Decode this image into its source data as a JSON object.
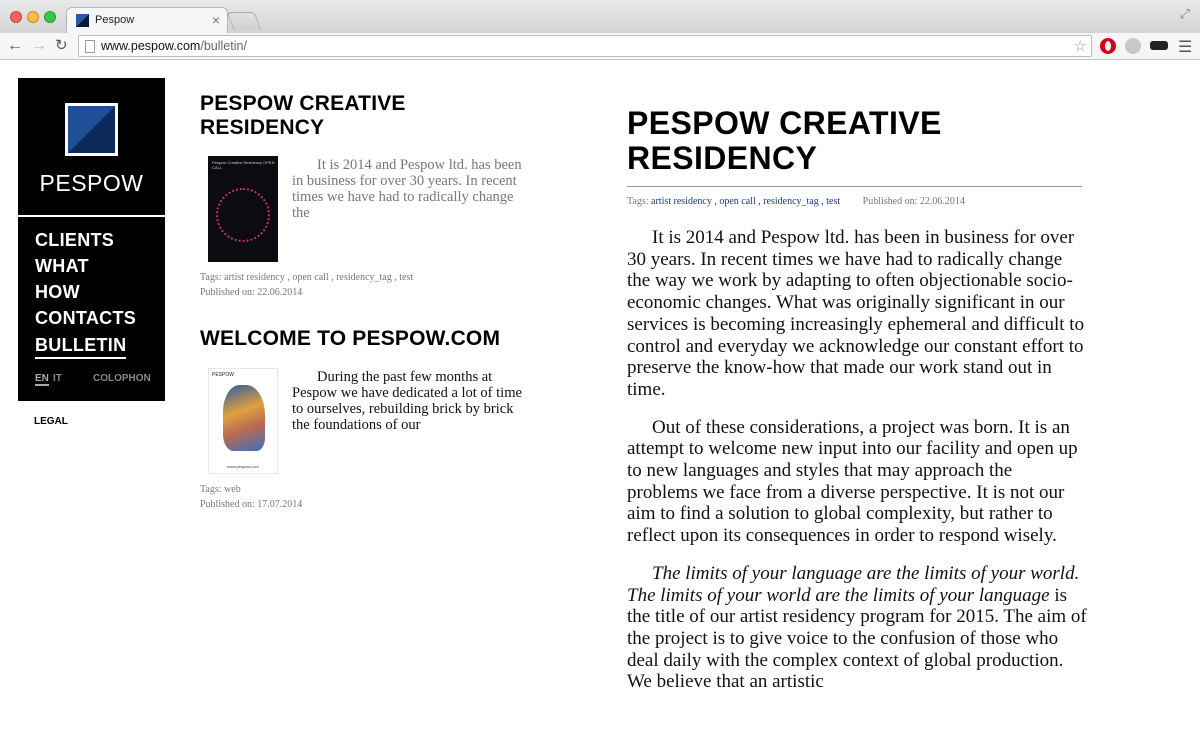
{
  "browser": {
    "tab_title": "Pespow",
    "tab_close": "×",
    "url_host": "www.pespow.com",
    "url_path": "/bulletin/",
    "icons": [
      "back-arrow-icon",
      "forward-arrow-icon",
      "reload-icon",
      "star-icon",
      "menu-icon"
    ]
  },
  "sidebar": {
    "logo_text": "PESPOW",
    "nav": [
      {
        "label": "CLIENTS"
      },
      {
        "label": "WHAT"
      },
      {
        "label": "HOW"
      },
      {
        "label": "CONTACTS"
      },
      {
        "label": "BULLETIN",
        "active": true
      }
    ],
    "lang_en": "EN",
    "lang_it": "IT",
    "colophon": "COLOPHON",
    "legal": "LEGAL"
  },
  "posts": [
    {
      "title_line1": "PESPOW CREATIVE",
      "title_line2": "RESIDENCY",
      "excerpt": "It is 2014 and Pespow ltd. has been in business for over 30 years. In recent times we have had to radically change the",
      "tags_label": "Tags:",
      "tags": "artist residency , open call , residency_tag , test",
      "published": "Published on: 22.06.2014"
    },
    {
      "title": "WELCOME TO PESPOW.COM",
      "excerpt": "During the past few months at Pespow we have dedicated a lot of time to ourselves, rebuilding brick by brick the foundations of our",
      "tags_label": "Tags:",
      "tags": "web",
      "published": "Published on: 17.07.2014"
    }
  ],
  "thumb1_text": "Pespow Creative Residency   OPEN CALL",
  "thumb2_brand": "PESPOW",
  "thumb2_foot": "www.pespow.com",
  "article": {
    "title_line1": "PESPOW CREATIVE",
    "title_line2": "RESIDENCY",
    "tags_label": "Tags:",
    "tags": [
      "artist residency",
      ", open call",
      ", residency_tag",
      ", test"
    ],
    "published": "Published on: 22.06.2014",
    "p1": "It is 2014 and Pespow ltd. has been in business for over 30 years. In recent times we have had to radically change the way we work by adapting to often objectionable socio-economic changes. What was originally significant in our services is becoming increasingly ephemeral and difficult to control and everyday we acknowledge our constant effort to preserve the know-how that made our work stand out in time.",
    "p2": "Out of these considerations, a project was born. It is an attempt to welcome new input into our facility and open up to new languages and styles that may approach the problems we face from a diverse perspective. It is not our aim to find a solution to global complexity, but rather to reflect upon its consequences in order to respond wisely.",
    "p3_italic": "The limits of your language are the limits of your world. The limits of your world are the limits of your language",
    "p3_rest": " is the title of our artist residency program for 2015. The aim of the project is to give voice to the confusion of those who deal daily with the complex context of global production. We believe that an artistic"
  }
}
